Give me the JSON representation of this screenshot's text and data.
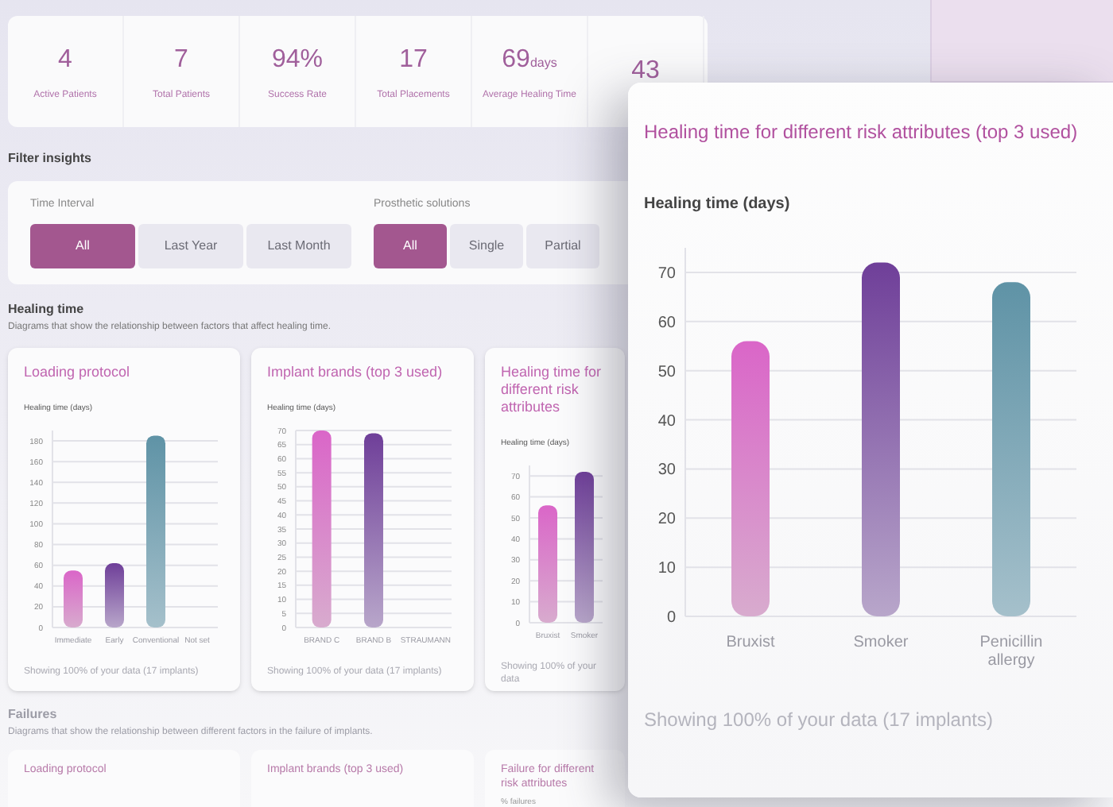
{
  "stats": [
    {
      "value": "4",
      "label": "Active Patients"
    },
    {
      "value": "7",
      "label": "Total Patients"
    },
    {
      "value": "94%",
      "label": "Success Rate"
    },
    {
      "value": "17",
      "label": "Total Placements"
    },
    {
      "value": "69",
      "unit": "days",
      "label": "Average Healing Time"
    },
    {
      "value": "43"
    }
  ],
  "filter": {
    "title": "Filter insights",
    "groups": [
      {
        "label": "Time Interval",
        "options": [
          {
            "label": "All",
            "selected": true
          },
          {
            "label": "Last Year",
            "selected": false
          },
          {
            "label": "Last Month",
            "selected": false
          }
        ]
      },
      {
        "label": "Prosthetic solutions",
        "options": [
          {
            "label": "All",
            "selected": true
          },
          {
            "label": "Single",
            "selected": false
          },
          {
            "label": "Partial",
            "selected": false
          }
        ]
      }
    ]
  },
  "healing": {
    "title": "Healing time",
    "description": "Diagrams that show the relationship between factors that affect healing time.",
    "cards": [
      {
        "title": "Loading protocol",
        "footer": "Showing 100% of your data (17 implants)",
        "chart_data": {
          "type": "bar",
          "ylabel": "Healing time (days)",
          "categories": [
            "Immediate",
            "Early",
            "Conventional",
            "Not set"
          ],
          "values": [
            55,
            62,
            185,
            0
          ],
          "grid": true,
          "ylim": [
            0,
            190
          ],
          "yticks": [
            0,
            20,
            40,
            60,
            80,
            100,
            120,
            140,
            160,
            180
          ]
        }
      },
      {
        "title": "Implant brands (top 3 used)",
        "footer": "Showing 100% of your data (17 implants)",
        "chart_data": {
          "type": "bar",
          "ylabel": "Healing time (days)",
          "categories": [
            "BRAND C",
            "BRAND B",
            "STRAUMANN"
          ],
          "values": [
            70,
            69,
            0
          ],
          "grid": true,
          "ylim": [
            0,
            70
          ],
          "yticks": [
            0,
            5,
            10,
            15,
            20,
            25,
            30,
            35,
            40,
            45,
            50,
            55,
            60,
            65,
            70
          ]
        }
      },
      {
        "title": "Healing time for different risk attributes",
        "footer": "Showing 100% of your data",
        "chart_data": {
          "type": "bar",
          "ylabel": "Healing time (days)",
          "categories": [
            "Bruxist",
            "Smoker"
          ],
          "values": [
            56,
            72
          ],
          "grid": true,
          "ylim": [
            0,
            75
          ],
          "yticks": [
            0,
            10,
            20,
            30,
            40,
            50,
            60,
            70
          ]
        }
      }
    ]
  },
  "failures": {
    "title": "Failures",
    "description": "Diagrams that show the relationship between different factors in the failure of implants.",
    "cards": [
      {
        "title": "Loading protocol"
      },
      {
        "title": "Implant brands (top 3 used)"
      },
      {
        "title": "Failure for different risk attributes",
        "ylabel": "% failures"
      }
    ]
  },
  "featured_card": {
    "title": "Healing time for different risk attributes (top 3 used)",
    "footer": "Showing 100% of your data (17 implants)",
    "chart_data": {
      "type": "bar",
      "ylabel": "Healing time (days)",
      "categories": [
        "Bruxist",
        "Smoker",
        "Penicillin allergy"
      ],
      "values": [
        56,
        72,
        68
      ],
      "grid": true,
      "ylim": [
        0,
        75
      ],
      "yticks": [
        0,
        10,
        20,
        30,
        40,
        50,
        60,
        70
      ]
    }
  }
}
